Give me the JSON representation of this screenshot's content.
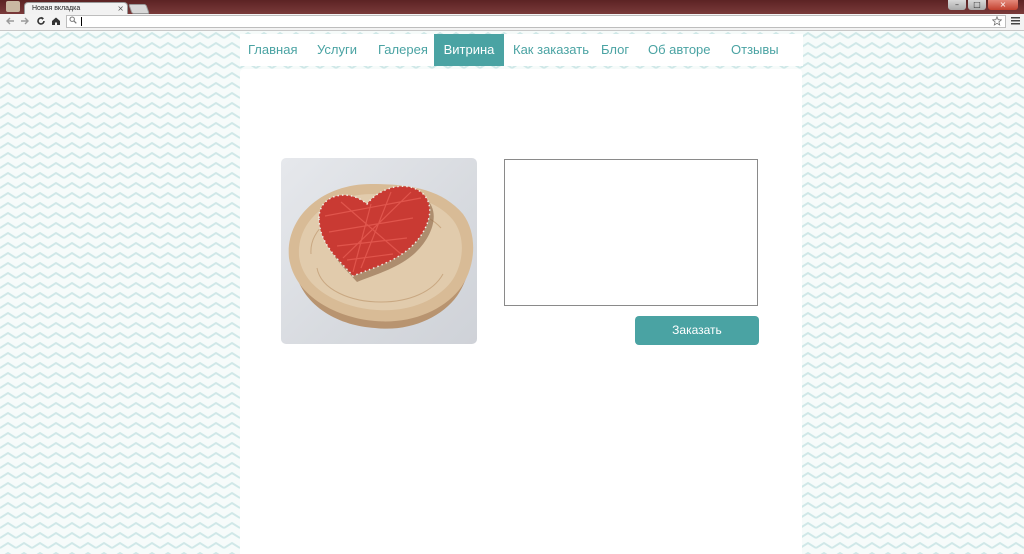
{
  "browser": {
    "tab_title": "Новая вкладка",
    "tab_close": "×",
    "win_minimize": "–",
    "win_maximize": "□",
    "win_close": "×",
    "address_value": ""
  },
  "nav": {
    "items": [
      {
        "label": "Главная"
      },
      {
        "label": "Услуги"
      },
      {
        "label": "Галерея"
      },
      {
        "label": "Витрина"
      },
      {
        "label": "Как заказать"
      },
      {
        "label": "Блог"
      },
      {
        "label": "Об авторе"
      },
      {
        "label": "Отзывы"
      }
    ],
    "active": "Витрина"
  },
  "product": {
    "order_text": "",
    "order_button": "Заказать"
  },
  "icons": {
    "back": "back-arrow-icon",
    "forward": "forward-arrow-icon",
    "reload": "reload-icon",
    "home": "home-icon",
    "search": "search-icon",
    "bookmark": "star-icon",
    "menu": "menu-icon"
  },
  "colors": {
    "accent": "#4aa3a3",
    "chevron": "#cfe8e8",
    "titlebar": "#6b2d2e"
  }
}
